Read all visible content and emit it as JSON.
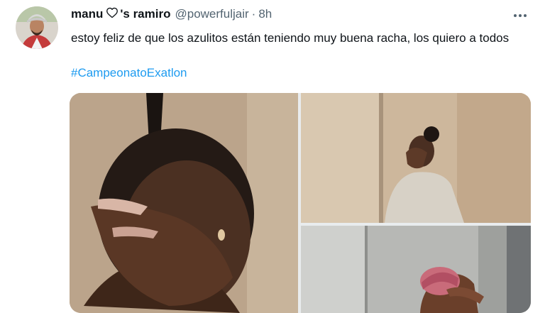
{
  "tweet": {
    "author": {
      "display_name": "manu",
      "heart_icon": "heart-outline-icon",
      "display_name_suffix": "'s ramiro",
      "handle": "@powerfuljair",
      "separator": "·",
      "time": "8h"
    },
    "text": "estoy feliz de que los azulitos están teniendo muy buena racha, los quiero a todos",
    "hashtag": "#CampeonatoExatlon",
    "more_icon": "more-horizontal-icon"
  },
  "colors": {
    "link": "#1d9bf0",
    "secondary_text": "#536471",
    "primary_text": "#0f1419"
  }
}
